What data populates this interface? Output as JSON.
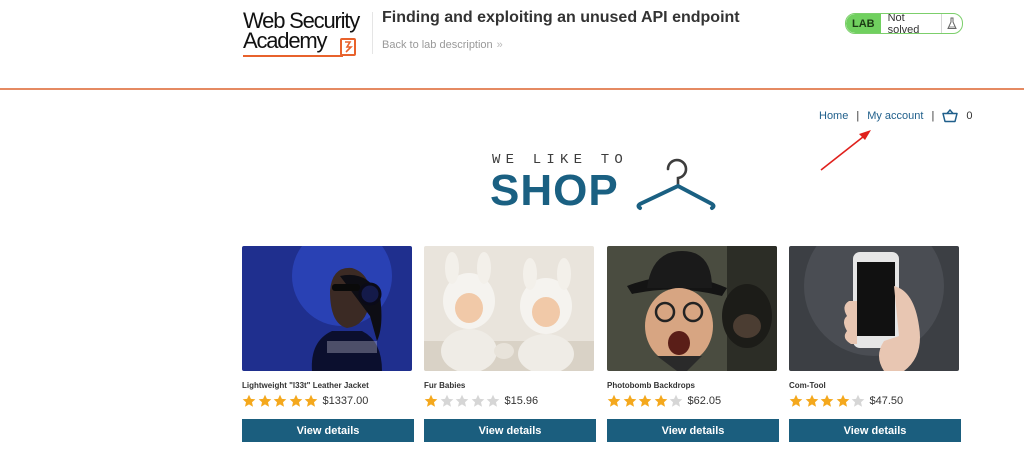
{
  "header": {
    "logo_line1": "Web Security",
    "logo_line2": "Academy",
    "lab_title": "Finding and exploiting an unused API endpoint",
    "back_link": "Back to lab description",
    "lab_badge": "LAB",
    "lab_status": "Not solved"
  },
  "nav": {
    "home": "Home",
    "separator": "|",
    "my_account": "My account",
    "cart_count": "0"
  },
  "banner": {
    "tagline": "WE LIKE TO",
    "headline": "SHOP"
  },
  "products": [
    {
      "name": "Lightweight \"l33t\" Leather Jacket",
      "rating": 5,
      "price": "$1337.00",
      "button": "View details"
    },
    {
      "name": "Fur Babies",
      "rating": 1,
      "price": "$15.96",
      "button": "View details"
    },
    {
      "name": "Photobomb Backdrops",
      "rating": 4,
      "price": "$62.05",
      "button": "View details"
    },
    {
      "name": "Com-Tool",
      "rating": 4,
      "price": "$47.50",
      "button": "View details"
    }
  ],
  "colors": {
    "accent_orange": "#e8622c",
    "brand_blue": "#1b5e7e",
    "star_filled": "#f4a81d",
    "star_empty": "#d6d6d6",
    "lab_green": "#70d05f",
    "annotation_arrow": "#e0201c"
  },
  "icons": {
    "cart": "cart-icon",
    "flask": "flask-icon",
    "hanger": "hanger-icon",
    "chevrons": "double-chevron-right-icon"
  }
}
